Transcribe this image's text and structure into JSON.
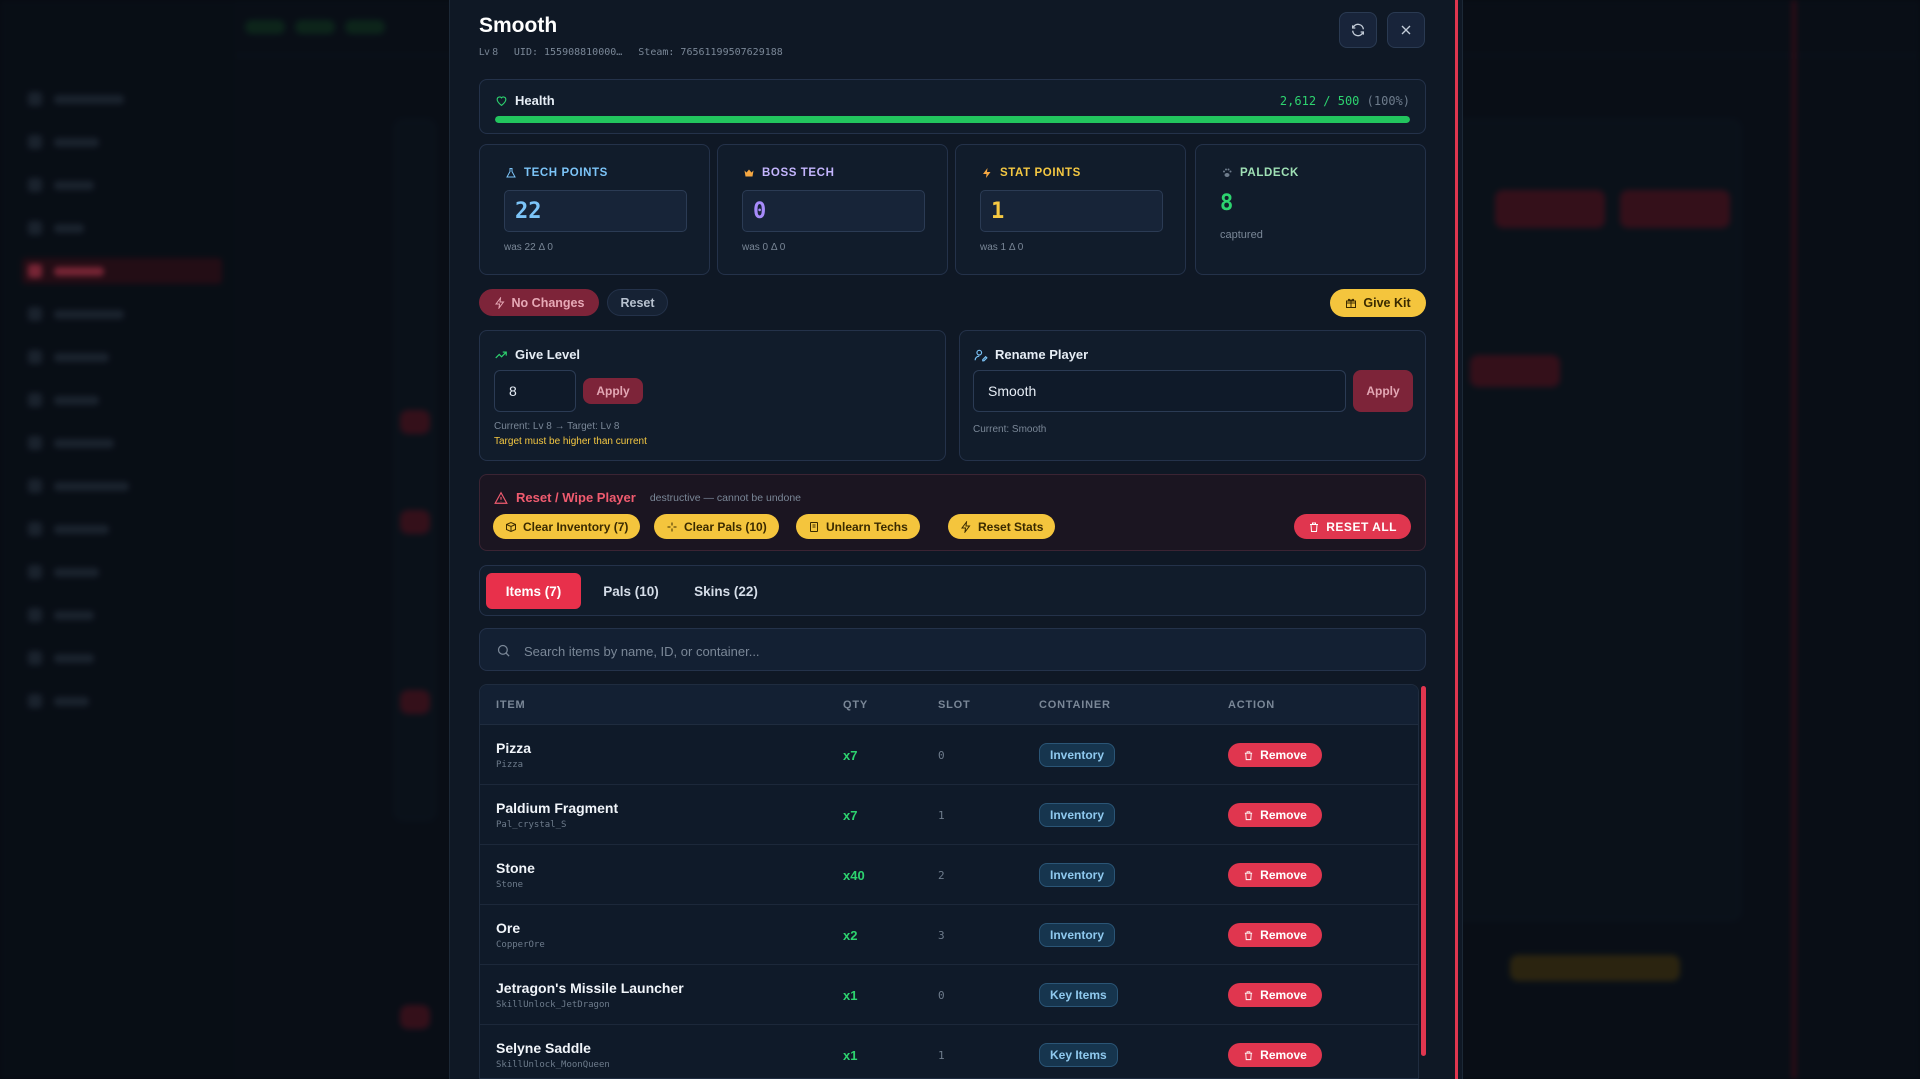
{
  "player": {
    "name": "Smooth",
    "level": "Lv 8",
    "uid": "UID: 155908810000…",
    "steam": "Steam: 76561199507629188"
  },
  "health": {
    "label": "Health",
    "value": "2,612 / 500",
    "pct": "(100%)",
    "fill": 1.0
  },
  "stats": {
    "tech": {
      "label": "TECH POINTS",
      "value": "22",
      "sub": "was 22  Δ 0",
      "color": "#7cc4f8"
    },
    "boss": {
      "label": "BOSS TECH",
      "value": "0",
      "sub": "was 0  Δ 0",
      "color": "#a78bfa"
    },
    "stat": {
      "label": "STAT POINTS",
      "value": "1",
      "sub": "was 1  Δ 0",
      "color": "#f5c842"
    },
    "paldeck": {
      "label": "PALDECK",
      "value": "8",
      "sub": "captured",
      "color": "#7cc4a0"
    }
  },
  "actions": {
    "no_changes": "No Changes",
    "reset": "Reset",
    "give_kit": "Give Kit"
  },
  "give_level": {
    "title": "Give Level",
    "value": "8",
    "apply": "Apply",
    "hint": "Current: Lv 8 → Target: Lv 8",
    "warning": "Target must be higher than current"
  },
  "rename": {
    "title": "Rename Player",
    "value": "Smooth",
    "apply": "Apply",
    "hint": "Current: Smooth"
  },
  "wipe": {
    "title": "Reset / Wipe Player",
    "note": "destructive — cannot be undone",
    "clear_inventory": "Clear Inventory (7)",
    "clear_pals": "Clear Pals (10)",
    "unlearn_techs": "Unlearn Techs",
    "reset_stats": "Reset Stats",
    "reset_all": "RESET ALL"
  },
  "tabs": [
    {
      "label": "Items (7)",
      "active": true
    },
    {
      "label": "Pals (10)",
      "active": false
    },
    {
      "label": "Skins (22)",
      "active": false
    }
  ],
  "search": {
    "placeholder": "Search items by name, ID, or container..."
  },
  "table": {
    "headers": {
      "item": "ITEM",
      "qty": "QTY",
      "slot": "SLOT",
      "container": "CONTAINER",
      "action": "ACTION"
    },
    "remove_label": "Remove",
    "rows": [
      {
        "name": "Pizza",
        "id": "Pizza",
        "qty": "x7",
        "slot": "0",
        "container": "Inventory"
      },
      {
        "name": "Paldium Fragment",
        "id": "Pal_crystal_S",
        "qty": "x7",
        "slot": "1",
        "container": "Inventory"
      },
      {
        "name": "Stone",
        "id": "Stone",
        "qty": "x40",
        "slot": "2",
        "container": "Inventory"
      },
      {
        "name": "Ore",
        "id": "CopperOre",
        "qty": "x2",
        "slot": "3",
        "container": "Inventory"
      },
      {
        "name": "Jetragon's Missile Launcher",
        "id": "SkillUnlock_JetDragon",
        "qty": "x1",
        "slot": "0",
        "container": "Key Items"
      },
      {
        "name": "Selyne Saddle",
        "id": "SkillUnlock_MoonQueen",
        "qty": "x1",
        "slot": "1",
        "container": "Key Items"
      }
    ]
  },
  "colors": {
    "accent": "#e0364f",
    "success": "#22c55e",
    "warning": "#f4c53d"
  }
}
